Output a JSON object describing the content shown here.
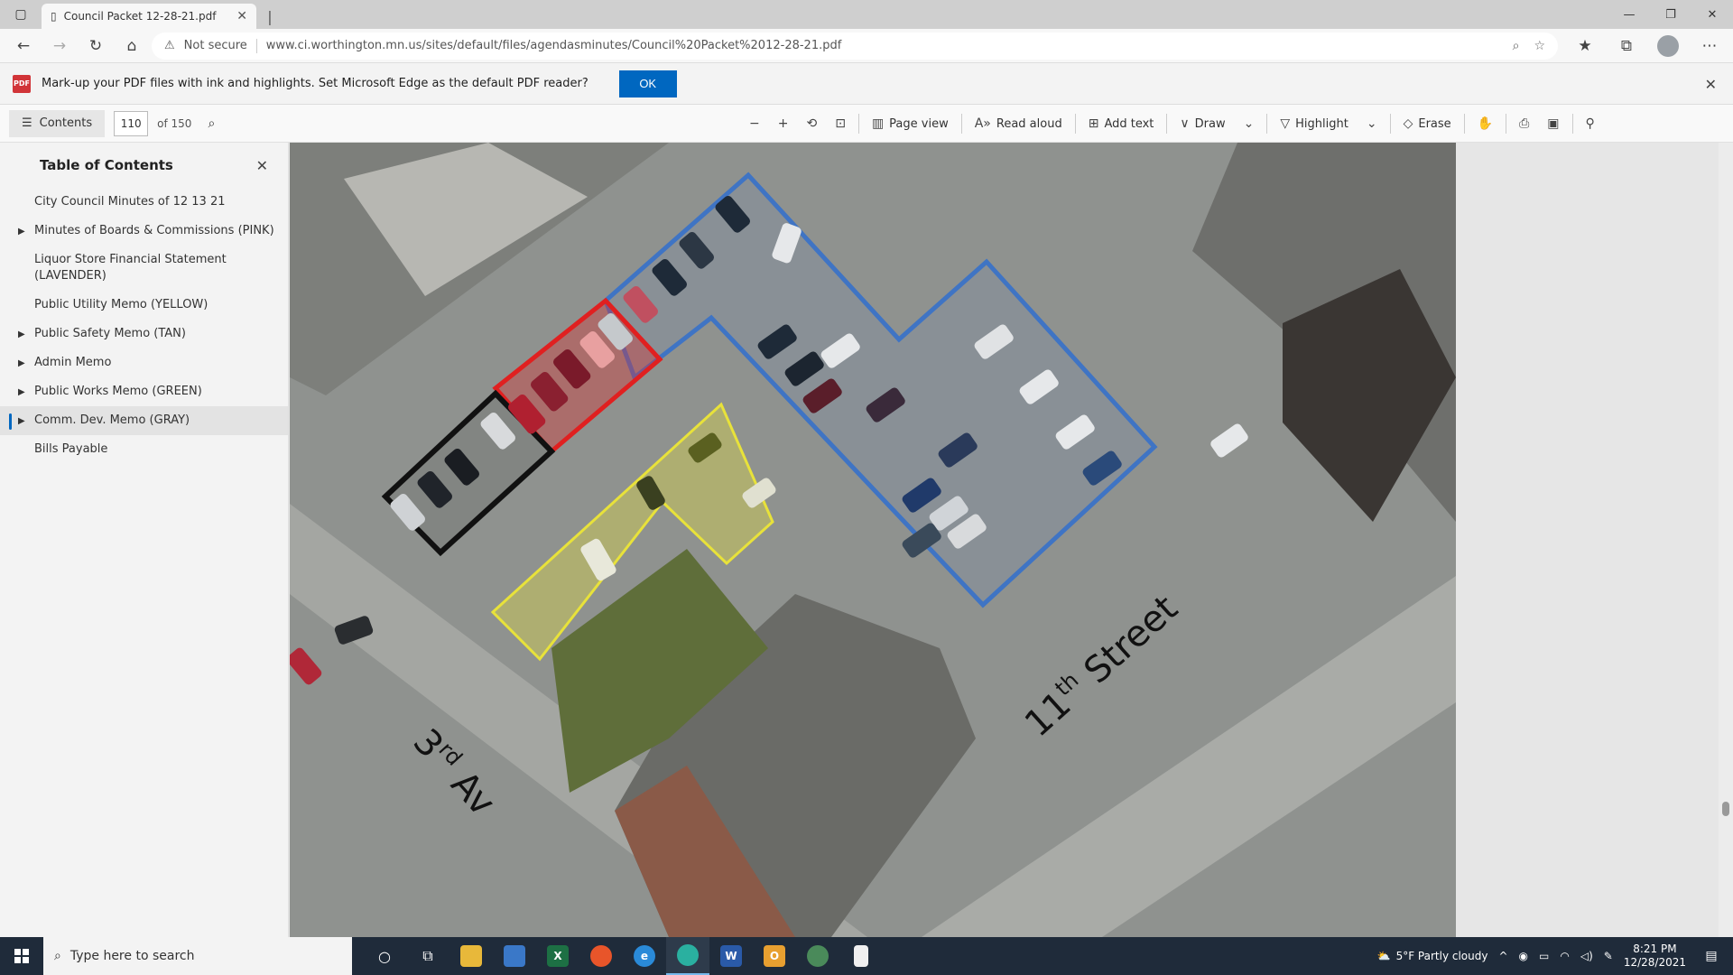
{
  "browser": {
    "tab_title": "Council Packet 12-28-21.pdf",
    "url_warning": "Not secure",
    "url": "www.ci.worthington.mn.us/sites/default/files/agendasminutes/Council%20Packet%2012-28-21.pdf"
  },
  "infobar": {
    "message": "Mark-up your PDF files with ink and highlights. Set Microsoft Edge as the default PDF reader?",
    "ok_label": "OK",
    "icon_label": "PDF"
  },
  "pdf_toolbar": {
    "contents_label": "Contents",
    "page_current": "110",
    "page_total": "of 150",
    "page_view": "Page view",
    "read_aloud": "Read aloud",
    "add_text": "Add text",
    "draw": "Draw",
    "highlight": "Highlight",
    "erase": "Erase"
  },
  "toc": {
    "title": "Table of Contents",
    "items": [
      {
        "label": "City Council Minutes of 12 13 21",
        "expandable": false
      },
      {
        "label": "Minutes of Boards & Commissions (PINK)",
        "expandable": true
      },
      {
        "label": "Liquor Store Financial Statement (LAVENDER)",
        "expandable": false
      },
      {
        "label": "Public Utility Memo (YELLOW)",
        "expandable": false
      },
      {
        "label": "Public Safety Memo (TAN)",
        "expandable": true
      },
      {
        "label": "Admin Memo",
        "expandable": true
      },
      {
        "label": "Public Works Memo (GREEN)",
        "expandable": true
      },
      {
        "label": "Comm. Dev. Memo (GRAY)",
        "expandable": true,
        "active": true
      },
      {
        "label": "Bills Payable",
        "expandable": false
      }
    ]
  },
  "map": {
    "street_label_1_main": "11",
    "street_label_1_sup": "th",
    "street_label_1_rest": " Street",
    "street_label_2_main": "3",
    "street_label_2_sup": "rd",
    "street_label_2_rest": " Av",
    "colors": {
      "blue_zone": "#3f74c4",
      "red_zone": "#e02020",
      "black_zone": "#111111",
      "yellow_zone": "#e8e23a"
    }
  },
  "taskbar": {
    "search_placeholder": "Type here to search",
    "weather": "5°F  Partly cloudy",
    "time": "8:21 PM",
    "date": "12/28/2021"
  }
}
